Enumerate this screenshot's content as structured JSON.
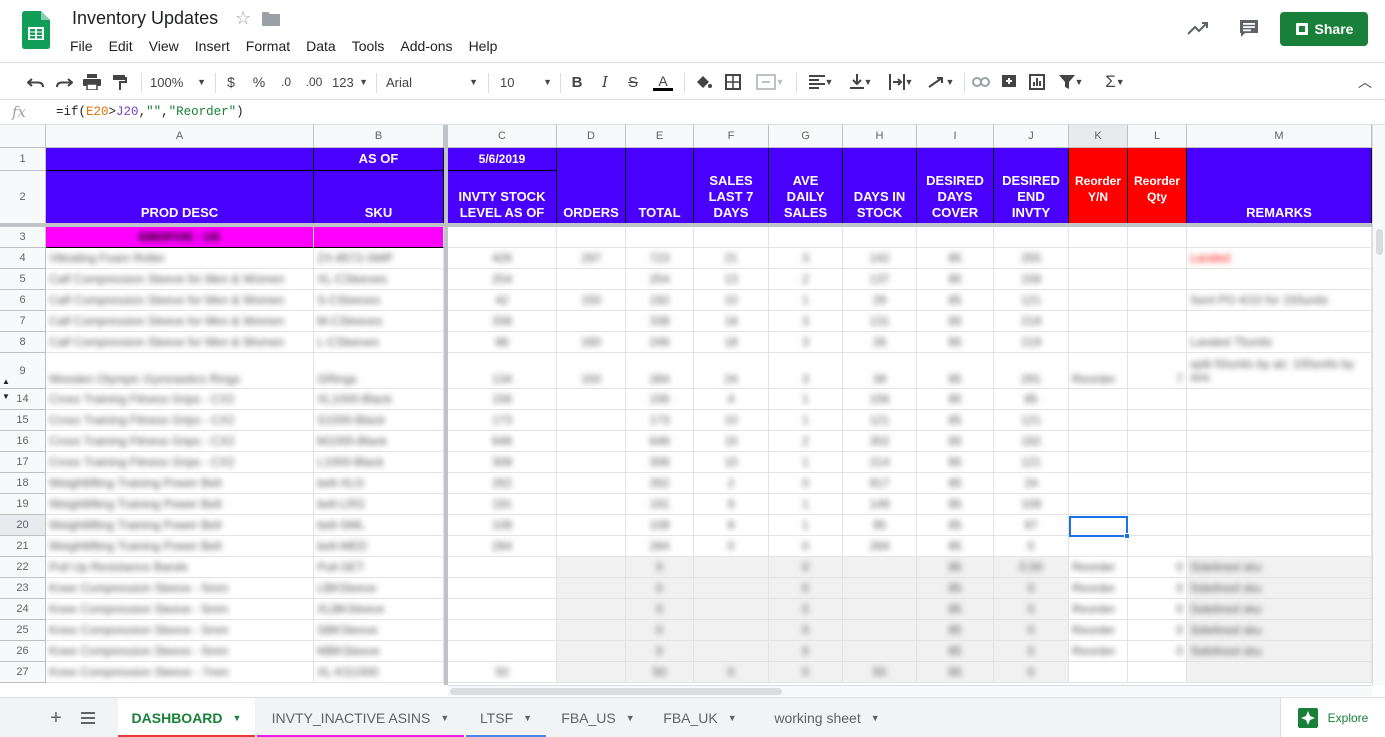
{
  "doc": {
    "title": "Inventory Updates"
  },
  "menu": [
    "File",
    "Edit",
    "View",
    "Insert",
    "Format",
    "Data",
    "Tools",
    "Add-ons",
    "Help"
  ],
  "share_label": "Share",
  "toolbar": {
    "zoom": "100%",
    "currency": "$",
    "percent": "%",
    "dec_less": ".0",
    "dec_more": ".00",
    "more_formats": "123",
    "font": "Arial",
    "font_size": "10"
  },
  "formula": {
    "prefix": "=if(",
    "ref1": "E20",
    "op": ">",
    "ref2": "J20",
    "sep": ",",
    "empty": "\"\"",
    "sep2": ",",
    "text": "\"Reorder\"",
    "close": ")"
  },
  "columns": [
    "A",
    "B",
    "C",
    "D",
    "E",
    "F",
    "G",
    "H",
    "I",
    "J",
    "K",
    "L",
    "M"
  ],
  "header": {
    "row1": {
      "as_of": "AS OF",
      "date": "5/6/2019"
    },
    "prod_desc": "PROD DESC",
    "sku": "SKU",
    "invty": "INVTY STOCK LEVEL AS OF",
    "orders": "ORDERS",
    "total": "TOTAL",
    "sales7": "SALES LAST 7 DAYS",
    "ave_daily": "AVE DAILY SALES",
    "days_in_stock": "DAYS IN STOCK",
    "desired_cover": "DESIRED DAYS COVER",
    "desired_end": "DESIRED END INVTY",
    "reorder_yn": "Reorder Y/N",
    "reorder_qty": "Reorder Qty",
    "remarks": "REMARKS"
  },
  "rows": [
    {
      "n": "3",
      "a": "EMOFIVE - US",
      "b": "",
      "c": "",
      "d": "",
      "e": "",
      "f": "",
      "g": "",
      "h": "",
      "i": "",
      "j": "",
      "k": "",
      "l": "",
      "m": ""
    },
    {
      "n": "4",
      "a": "Vibrating Foam Roller",
      "b": "ZX-8572-SMP",
      "c": "426",
      "d": "297",
      "e": "723",
      "f": "21",
      "g": "3",
      "h": "142",
      "i": "85",
      "j": "255",
      "k": "",
      "l": "",
      "m": "Landed"
    },
    {
      "n": "5",
      "a": "Calf Compression Sleeve for Men & Women",
      "b": "XL-CSleeves",
      "c": "254",
      "d": "",
      "e": "254",
      "f": "13",
      "g": "2",
      "h": "137",
      "i": "85",
      "j": "158",
      "k": "",
      "l": "",
      "m": ""
    },
    {
      "n": "6",
      "a": "Calf Compression Sleeve for Men & Women",
      "b": "S-CSleeves",
      "c": "42",
      "d": "150",
      "e": "192",
      "f": "10",
      "g": "1",
      "h": "29",
      "i": "85",
      "j": "121",
      "k": "",
      "l": "",
      "m": "Sent PO 4/10 for 150units"
    },
    {
      "n": "7",
      "a": "Calf Compression Sleeve for Men & Women",
      "b": "M-CSleeves",
      "c": "338",
      "d": "",
      "e": "338",
      "f": "18",
      "g": "3",
      "h": "131",
      "i": "85",
      "j": "219",
      "k": "",
      "l": "",
      "m": ""
    },
    {
      "n": "8",
      "a": "Calf Compression Sleeve for Men & Women",
      "b": "L-CSleeves",
      "c": "86",
      "d": "160",
      "e": "246",
      "f": "18",
      "g": "3",
      "h": "26",
      "i": "85",
      "j": "219",
      "k": "",
      "l": "",
      "m": "Landed 75units"
    },
    {
      "n": "9",
      "a": "Wooden Olympic Gymnastics Rings",
      "b": "GRings",
      "c": "134",
      "d": "150",
      "e": "284",
      "f": "24",
      "g": "3",
      "h": "39",
      "i": "85",
      "j": "291",
      "k": "Reorder",
      "l": "7",
      "m": "split 50units by air; 100units by sea"
    },
    {
      "n": "14",
      "a": "Cross Training Fitness Grips - CX2",
      "b": "XL1000-Black",
      "c": "156",
      "d": "",
      "e": "156",
      "f": "4",
      "g": "1",
      "h": "156",
      "i": "85",
      "j": "85",
      "k": "",
      "l": "",
      "m": ""
    },
    {
      "n": "15",
      "a": "Cross Training Fitness Grips - CX2",
      "b": "S1000-Black",
      "c": "173",
      "d": "",
      "e": "173",
      "f": "10",
      "g": "1",
      "h": "121",
      "i": "85",
      "j": "121",
      "k": "",
      "l": "",
      "m": ""
    },
    {
      "n": "16",
      "a": "Cross Training Fitness Grips - CX2",
      "b": "M1000-Black",
      "c": "648",
      "d": "",
      "e": "648",
      "f": "15",
      "g": "2",
      "h": "302",
      "i": "85",
      "j": "182",
      "k": "",
      "l": "",
      "m": ""
    },
    {
      "n": "17",
      "a": "Cross Training Fitness Grips - CX2",
      "b": "L1000-Black",
      "c": "308",
      "d": "",
      "e": "308",
      "f": "10",
      "g": "1",
      "h": "214",
      "i": "85",
      "j": "121",
      "k": "",
      "l": "",
      "m": ""
    },
    {
      "n": "18",
      "a": "Weightlifting Training Power Belt",
      "b": "belt-XLG",
      "c": "262",
      "d": "",
      "e": "262",
      "f": "2",
      "g": "0",
      "h": "917",
      "i": "85",
      "j": "24",
      "k": "",
      "l": "",
      "m": ""
    },
    {
      "n": "19",
      "a": "Weightlifting Training Power Belt",
      "b": "belt-LRG",
      "c": "191",
      "d": "",
      "e": "191",
      "f": "9",
      "g": "1",
      "h": "149",
      "i": "85",
      "j": "109",
      "k": "",
      "l": "",
      "m": ""
    },
    {
      "n": "20",
      "a": "Weightlifting Training Power Belt",
      "b": "belt-SML",
      "c": "108",
      "d": "",
      "e": "108",
      "f": "8",
      "g": "1",
      "h": "95",
      "i": "85",
      "j": "97",
      "k": "",
      "l": "",
      "m": ""
    },
    {
      "n": "21",
      "a": "Weightlifting Training Power Belt",
      "b": "belt-MED",
      "c": "284",
      "d": "",
      "e": "284",
      "f": "0",
      "g": "0",
      "h": "284",
      "i": "85",
      "j": "0",
      "k": "",
      "l": "",
      "m": ""
    },
    {
      "n": "22",
      "a": "Pull Up Resistance Bands",
      "b": "Pull-SET",
      "c": "",
      "d": "",
      "e": "0",
      "f": "",
      "g": "0",
      "h": "",
      "i": "85",
      "j": "0.00",
      "k": "Reorder",
      "l": "0",
      "m": "Sidelined sku"
    },
    {
      "n": "23",
      "a": "Knee Compression Sleeve - 5mm",
      "b": "LBKSleeve",
      "c": "",
      "d": "",
      "e": "0",
      "f": "",
      "g": "0",
      "h": "",
      "i": "85",
      "j": "0",
      "k": "Reorder",
      "l": "0",
      "m": "Sidelined sku"
    },
    {
      "n": "24",
      "a": "Knee Compression Sleeve - 5mm",
      "b": "XLBKSleeve",
      "c": "",
      "d": "",
      "e": "0",
      "f": "",
      "g": "0",
      "h": "",
      "i": "85",
      "j": "0",
      "k": "Reorder",
      "l": "0",
      "m": "Sidelined sku"
    },
    {
      "n": "25",
      "a": "Knee Compression Sleeve - 5mm",
      "b": "SBKSleeve",
      "c": "",
      "d": "",
      "e": "0",
      "f": "",
      "g": "0",
      "h": "",
      "i": "85",
      "j": "0",
      "k": "Reorder",
      "l": "0",
      "m": "Sidelined sku"
    },
    {
      "n": "26",
      "a": "Knee Compression Sleeve - 5mm",
      "b": "MBKSleeve",
      "c": "",
      "d": "",
      "e": "0",
      "f": "",
      "g": "0",
      "h": "",
      "i": "85",
      "j": "0",
      "k": "Reorder",
      "l": "0",
      "m": "Sidelined sku"
    },
    {
      "n": "27",
      "a": "Knee Compression Sleeve - 7mm",
      "b": "XL-KS1000",
      "c": "50",
      "d": "",
      "e": "50",
      "f": "0",
      "g": "0",
      "h": "50",
      "i": "85",
      "j": "0",
      "k": "",
      "l": "",
      "m": ""
    }
  ],
  "tabs": [
    {
      "label": "DASHBOARD",
      "color": "#e53935"
    },
    {
      "label": "INVTY_INACTIVE ASINS",
      "color": "#e91ee6"
    },
    {
      "label": "LTSF",
      "color": "#4a86e8"
    },
    {
      "label": "FBA_US",
      "color": ""
    },
    {
      "label": "FBA_UK",
      "color": ""
    },
    {
      "label": "working sheet",
      "color": ""
    }
  ],
  "explore_label": "Explore",
  "colors": {
    "header_blue": "#4a00ff",
    "header_red": "#ff0000",
    "section_pink": "#ff00ff",
    "sheets_green": "#188038"
  }
}
